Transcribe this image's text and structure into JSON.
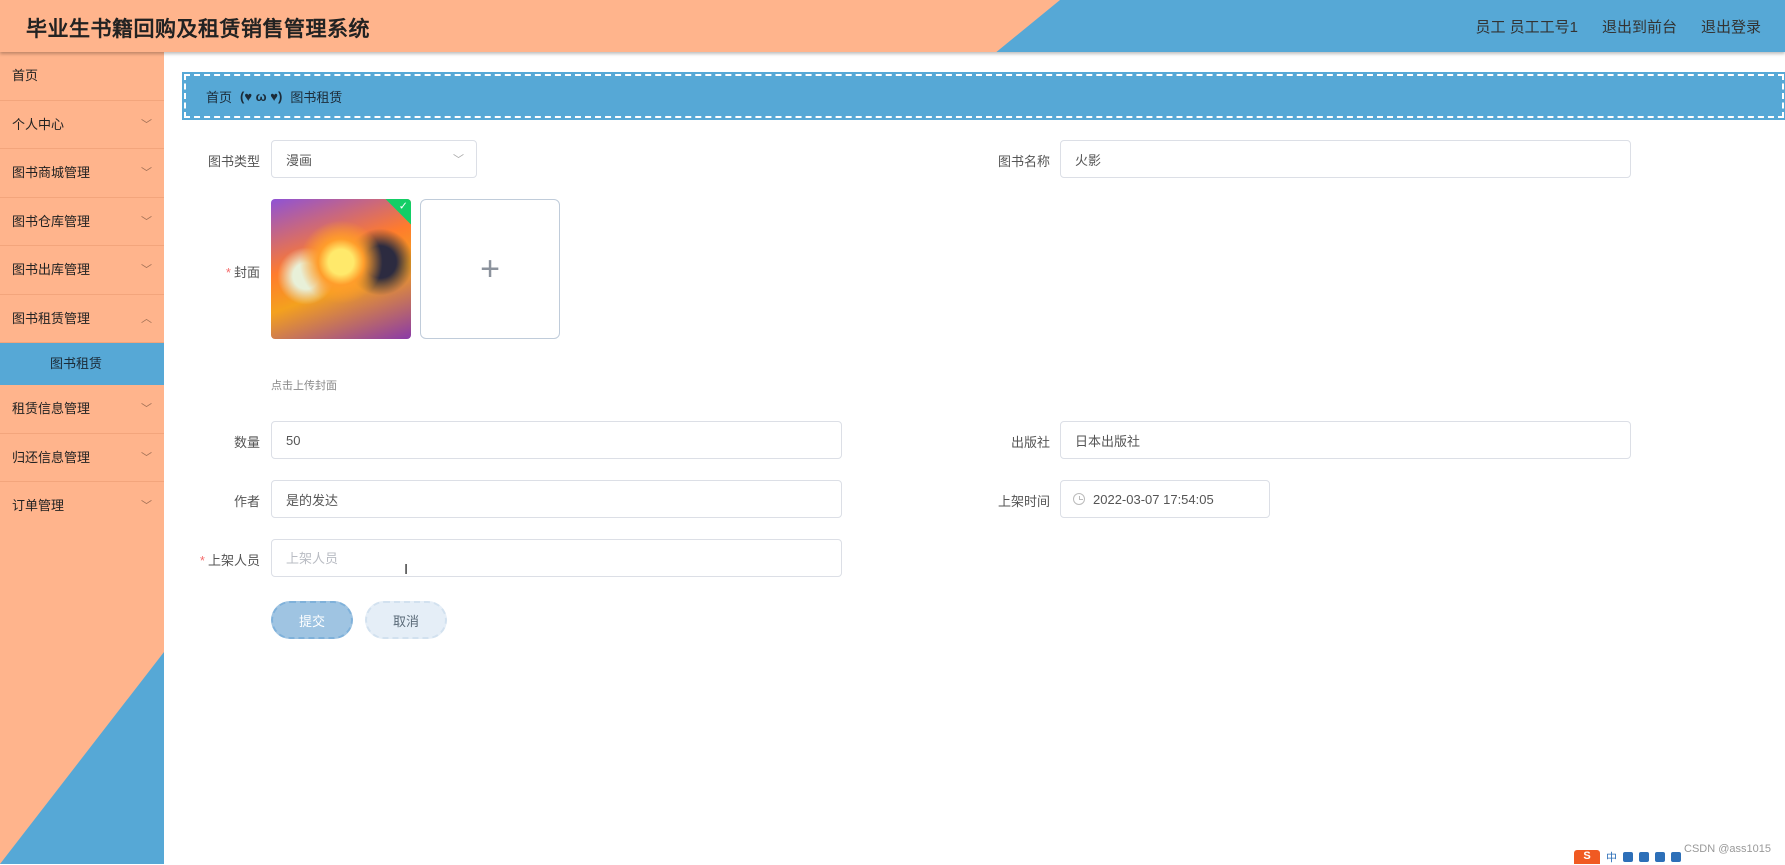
{
  "header": {
    "title": "毕业生书籍回购及租赁销售管理系统",
    "user": "员工 员工工号1",
    "link_frontend": "退出到前台",
    "link_logout": "退出登录"
  },
  "sidebar": {
    "items": [
      {
        "label": "首页",
        "chevron": false
      },
      {
        "label": "个人中心",
        "chevron": true
      },
      {
        "label": "图书商城管理",
        "chevron": true
      },
      {
        "label": "图书仓库管理",
        "chevron": true
      },
      {
        "label": "图书出库管理",
        "chevron": true
      },
      {
        "label": "图书租赁管理",
        "chevron": true
      }
    ],
    "active_sub": "图书租赁",
    "items_after": [
      {
        "label": "租赁信息管理",
        "chevron": true
      },
      {
        "label": "归还信息管理",
        "chevron": true
      },
      {
        "label": "订单管理",
        "chevron": true
      }
    ]
  },
  "breadcrumb": {
    "home": "首页",
    "deco": "(♥ ω ♥)",
    "current": "图书租赁"
  },
  "form": {
    "book_type": {
      "label": "图书类型",
      "value": "漫画"
    },
    "book_name": {
      "label": "图书名称",
      "value": "火影"
    },
    "cover": {
      "label": "封面",
      "tip": "点击上传封面",
      "plus": "+"
    },
    "quantity": {
      "label": "数量",
      "value": "50"
    },
    "publisher": {
      "label": "出版社",
      "value": "日本出版社"
    },
    "author": {
      "label": "作者",
      "value": "是的发达"
    },
    "shelf_time": {
      "label": "上架时间",
      "value": "2022-03-07 17:54:05"
    },
    "shelf_person": {
      "label": "上架人员",
      "placeholder": "上架人员",
      "value": ""
    },
    "required_mark": "*",
    "submit": "提交",
    "cancel": "取消"
  },
  "watermark": "CSDN @ass1015",
  "tray": {
    "s": "S",
    "ime": "中"
  },
  "colors": {
    "peach": "#ffb48c",
    "blue": "#56a8d6",
    "required": "#f56c6c"
  }
}
